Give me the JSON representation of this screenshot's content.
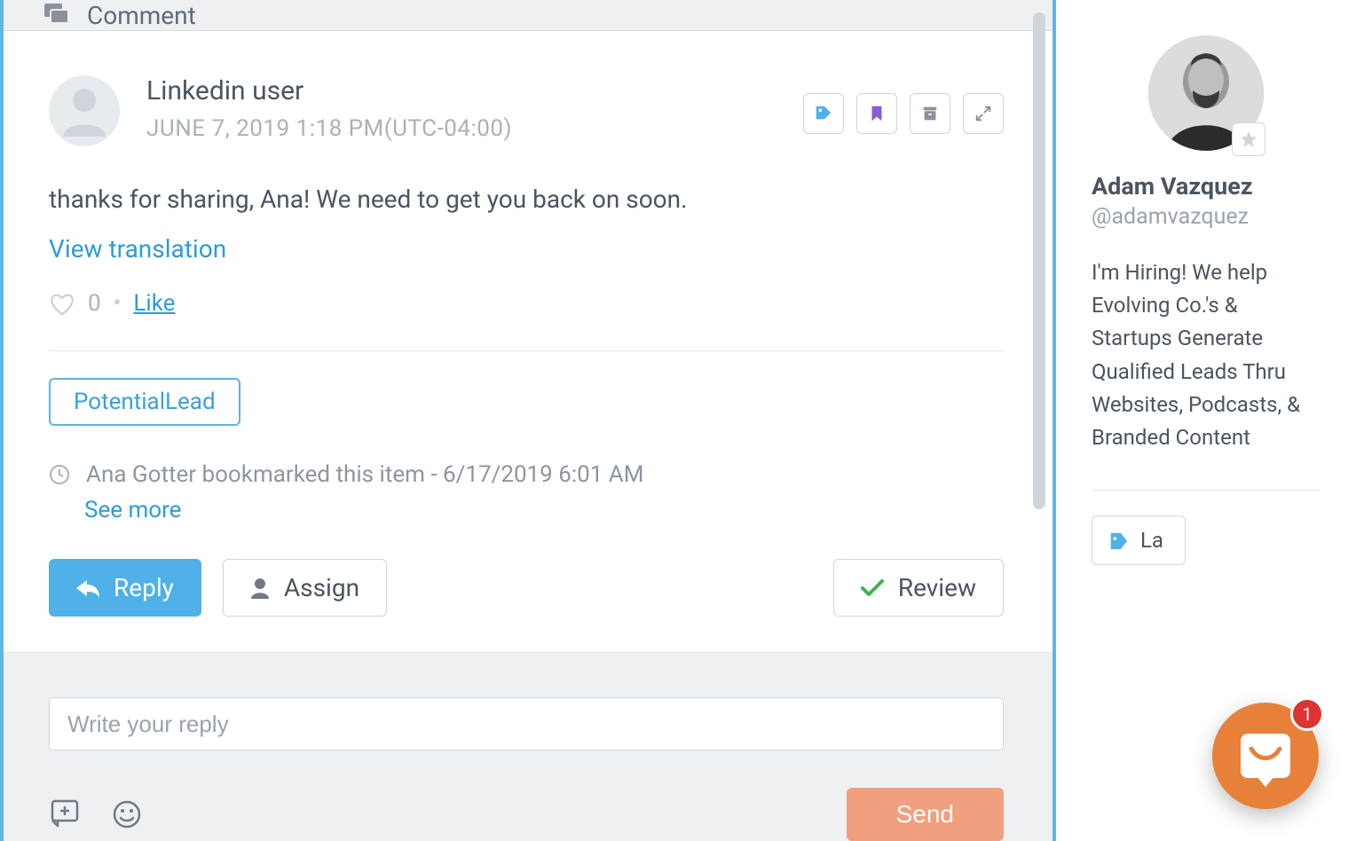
{
  "topbar": {
    "title": "Comment"
  },
  "comment": {
    "author": "Linkedin user",
    "timestamp": "JUNE 7, 2019 1:18 PM(UTC-04:00)",
    "body": "thanks for sharing, Ana! We need to get you back on soon.",
    "translate_label": "View translation",
    "likes_count": "0",
    "like_label": "Like",
    "tag_label": "PotentialLead",
    "history_text": "Ana Gotter bookmarked this item - 6/17/2019 6:01 AM",
    "see_more_label": "See more",
    "reply_label": "Reply",
    "assign_label": "Assign",
    "review_label": "Review"
  },
  "reply": {
    "placeholder": "Write your reply",
    "send_label": "Send"
  },
  "profile": {
    "name": "Adam Vazquez",
    "handle": "@adamvazquez",
    "bio": "I'm Hiring! We help Evolving Co.'s & Startups Generate Qualified Leads Thru Websites, Podcasts, & Branded Content",
    "side_button_label": "La"
  },
  "chat": {
    "badge": "1"
  }
}
